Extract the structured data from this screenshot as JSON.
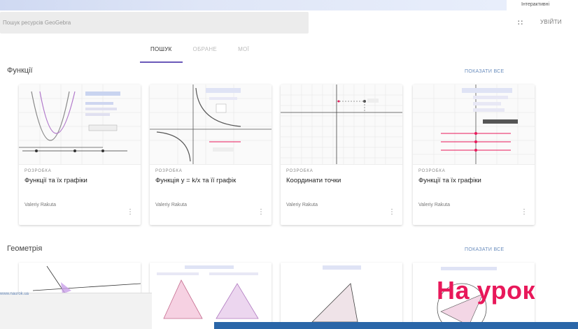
{
  "header": {
    "top_right": "Інтерактивні",
    "search_placeholder": "Пошук ресурсів GeoGebra",
    "sign_in": "УВІЙТИ"
  },
  "tabs": [
    {
      "label": "ПОШУК",
      "active": true
    },
    {
      "label": "ОБРАНЕ",
      "active": false
    },
    {
      "label": "МОЇ",
      "active": false
    }
  ],
  "sections": [
    {
      "title": "Функції",
      "show_all": "ПОКАЗАТИ ВСЕ",
      "cards": [
        {
          "type": "РОЗРОБКА",
          "title": "Функції та їх графіки",
          "author": "Valeriy Rakuta"
        },
        {
          "type": "РОЗРОБКА",
          "title": "Функція y = k/x та її графік",
          "author": "Valeriy Rakuta"
        },
        {
          "type": "РОЗРОБКА",
          "title": "Координати точки",
          "author": "Valeriy Rakuta"
        },
        {
          "type": "РОЗРОБКА",
          "title": "Функції та їх графіки",
          "author": "Valeriy Rakuta"
        }
      ]
    },
    {
      "title": "Геометрія",
      "show_all": "ПОКАЗАТИ ВСЕ"
    }
  ],
  "overlay_small_text": "www.naurok.ua",
  "overlay_big_text": "На урок",
  "colors": {
    "accent": "#6a59b9",
    "link": "#6a8dbd",
    "headline": "#e8185a",
    "bar": "#2a66a8"
  }
}
